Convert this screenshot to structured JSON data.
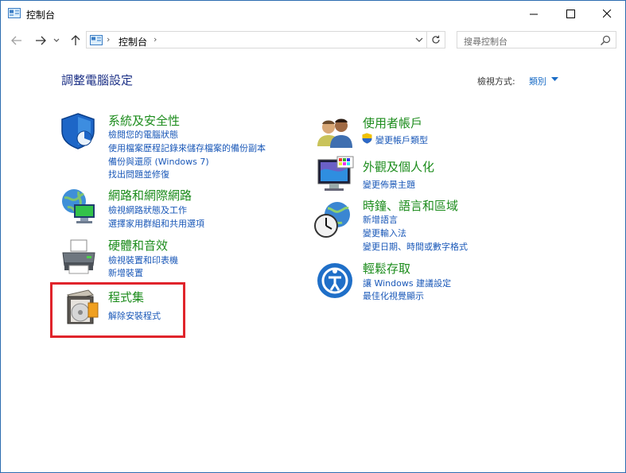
{
  "window": {
    "title": "控制台"
  },
  "address": {
    "crumb": "控制台",
    "sep": "›"
  },
  "search": {
    "placeholder": "搜尋控制台"
  },
  "content": {
    "page_title": "調整電腦設定",
    "view_by_label": "檢視方式:",
    "view_by_value": "類別"
  },
  "left_categories": [
    {
      "title": "系統及安全性",
      "icon": "shield-icon",
      "links": [
        "檢閱您的電腦狀態",
        "使用檔案歷程記錄來儲存檔案的備份副本",
        "備份與還原 (Windows 7)",
        "找出問題並修復"
      ]
    },
    {
      "title": "網路和網際網路",
      "icon": "network-globe-icon",
      "links": [
        "檢視網路狀態及工作",
        "選擇家用群組和共用選項"
      ]
    },
    {
      "title": "硬體和音效",
      "icon": "printer-icon",
      "links": [
        "檢視裝置和印表機",
        "新增裝置"
      ]
    },
    {
      "title": "程式集",
      "icon": "programs-disc-icon",
      "links": [
        "解除安裝程式"
      ]
    }
  ],
  "right_categories": [
    {
      "title": "使用者帳戶",
      "icon": "users-icon",
      "links": [
        "變更帳戶類型"
      ]
    },
    {
      "title": "外觀及個人化",
      "icon": "monitor-palette-icon",
      "links": [
        "變更佈景主題"
      ]
    },
    {
      "title": "時鐘、語言和區域",
      "icon": "clock-globe-icon",
      "links": [
        "新增語言",
        "變更輸入法",
        "變更日期、時間或數字格式"
      ]
    },
    {
      "title": "輕鬆存取",
      "icon": "ease-of-access-icon",
      "links": [
        "讓 Windows 建議設定",
        "最佳化視覺顯示"
      ]
    }
  ],
  "colors": {
    "title_green": "#1c8c1c",
    "link_blue": "#1a58b8",
    "highlight_red": "#e0242b"
  }
}
